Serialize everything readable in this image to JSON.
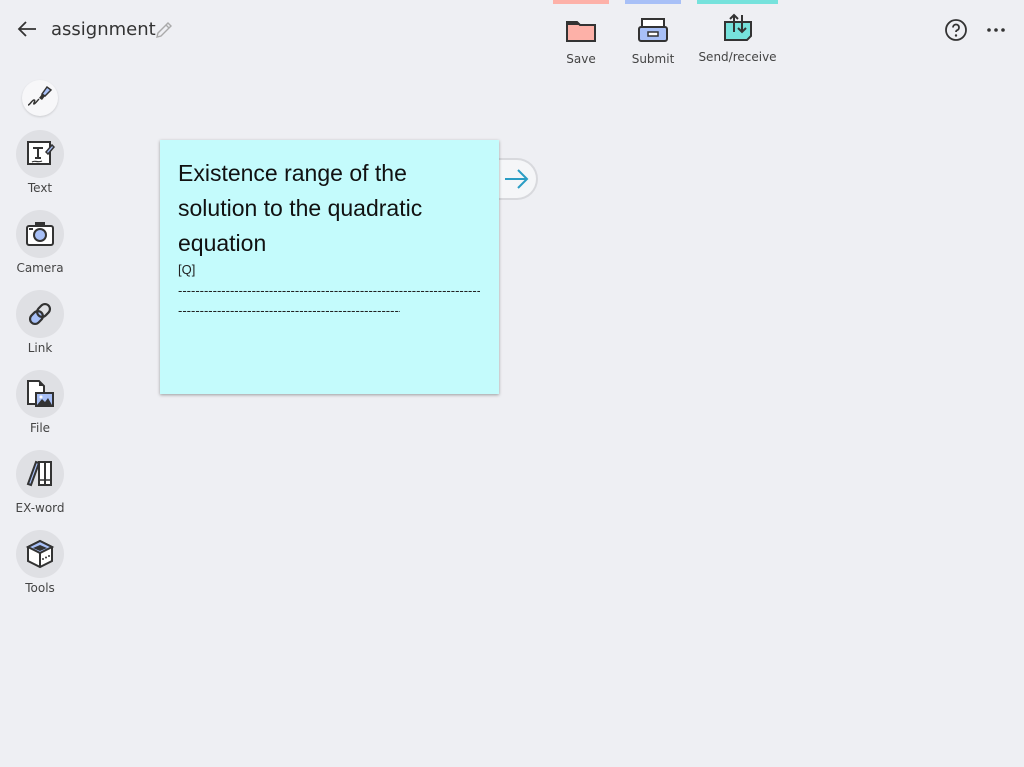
{
  "header": {
    "title": "assignment",
    "back_icon": "arrow-left-icon",
    "edit_icon": "pencil-icon",
    "help_icon": "question-circle-icon",
    "more_icon": "ellipsis-icon"
  },
  "toolbar": {
    "items": [
      {
        "label": "Save",
        "icon": "folder-icon",
        "color": "#fdb1a8"
      },
      {
        "label": "Submit",
        "icon": "drawer-icon",
        "color": "#a8c0f7"
      },
      {
        "label": "Send/receive",
        "icon": "send-receive-icon",
        "color": "#76e2dc"
      }
    ]
  },
  "sidebar": {
    "pen_icon": "pen-icon",
    "items": [
      {
        "label": "Text",
        "icon": "text-icon"
      },
      {
        "label": "Camera",
        "icon": "camera-icon"
      },
      {
        "label": "Link",
        "icon": "link-icon"
      },
      {
        "label": "File",
        "icon": "file-image-icon"
      },
      {
        "label": "EX-word",
        "icon": "books-icon"
      },
      {
        "label": "Tools",
        "icon": "toolbox-icon"
      }
    ]
  },
  "card": {
    "title": "Existence range of the solution to the quadratic equation",
    "question_label": "[Q]",
    "dash_line_1": "------------------------------------------------------------------------------------",
    "dash_line_2": "------------------------------------------------------------------------------------",
    "color": "#c4fbfc",
    "next_icon": "arrow-right-icon"
  }
}
